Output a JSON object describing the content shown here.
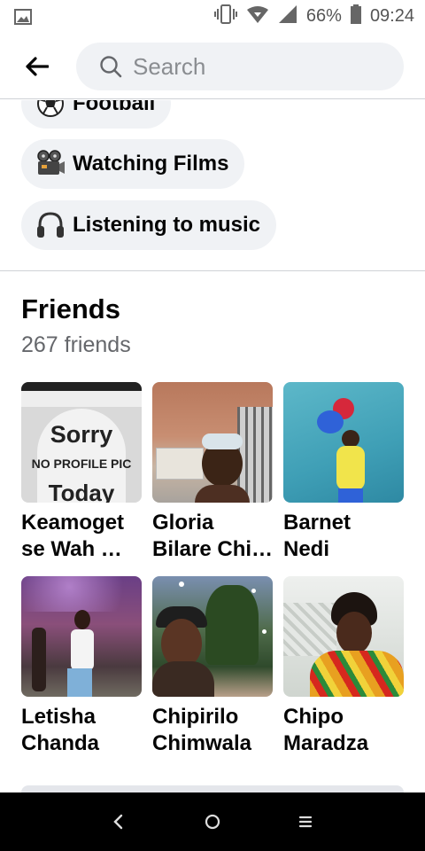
{
  "status_bar": {
    "battery_percent": "66%",
    "time": "09:24",
    "icons": [
      "image-icon",
      "vibrate-icon",
      "wifi-icon",
      "signal-icon",
      "battery-icon"
    ]
  },
  "header": {
    "search_placeholder": "Search",
    "icons": [
      "back-arrow-icon",
      "search-icon"
    ]
  },
  "hobbies": [
    {
      "emoji": "soccer-ball-icon",
      "label": "Football"
    },
    {
      "emoji": "film-projector-icon",
      "label": "Watching Films"
    },
    {
      "emoji": "headphones-icon",
      "label": "Listening to music"
    }
  ],
  "friends": {
    "title": "Friends",
    "count": "267 friends",
    "list": [
      {
        "name": "Keamogetse Wah …",
        "line1": "Keamoget",
        "line2": "se Wah …",
        "photo_text": [
          "Sorry",
          "NO PROFILE PIC",
          "Today"
        ]
      },
      {
        "name": "Gloria Bilare Chi…",
        "line1": "Gloria",
        "line2": "Bilare Chi…"
      },
      {
        "name": "Barnet Nedi",
        "line1": "Barnet",
        "line2": "Nedi"
      },
      {
        "name": "Letisha Chanda",
        "line1": "Letisha",
        "line2": "Chanda"
      },
      {
        "name": "Chipirilo Chimwala",
        "line1": "Chipirilo",
        "line2": "Chimwala"
      },
      {
        "name": "Chipo Maradza",
        "line1": "Chipo",
        "line2": "Maradza"
      }
    ]
  },
  "nav_bar": {
    "icons": [
      "nav-back-icon",
      "nav-home-icon",
      "nav-menu-icon"
    ]
  },
  "colors": {
    "chip_bg": "#f0f2f5",
    "secondary_text": "#65676b",
    "divider": "#cfd2d6"
  }
}
